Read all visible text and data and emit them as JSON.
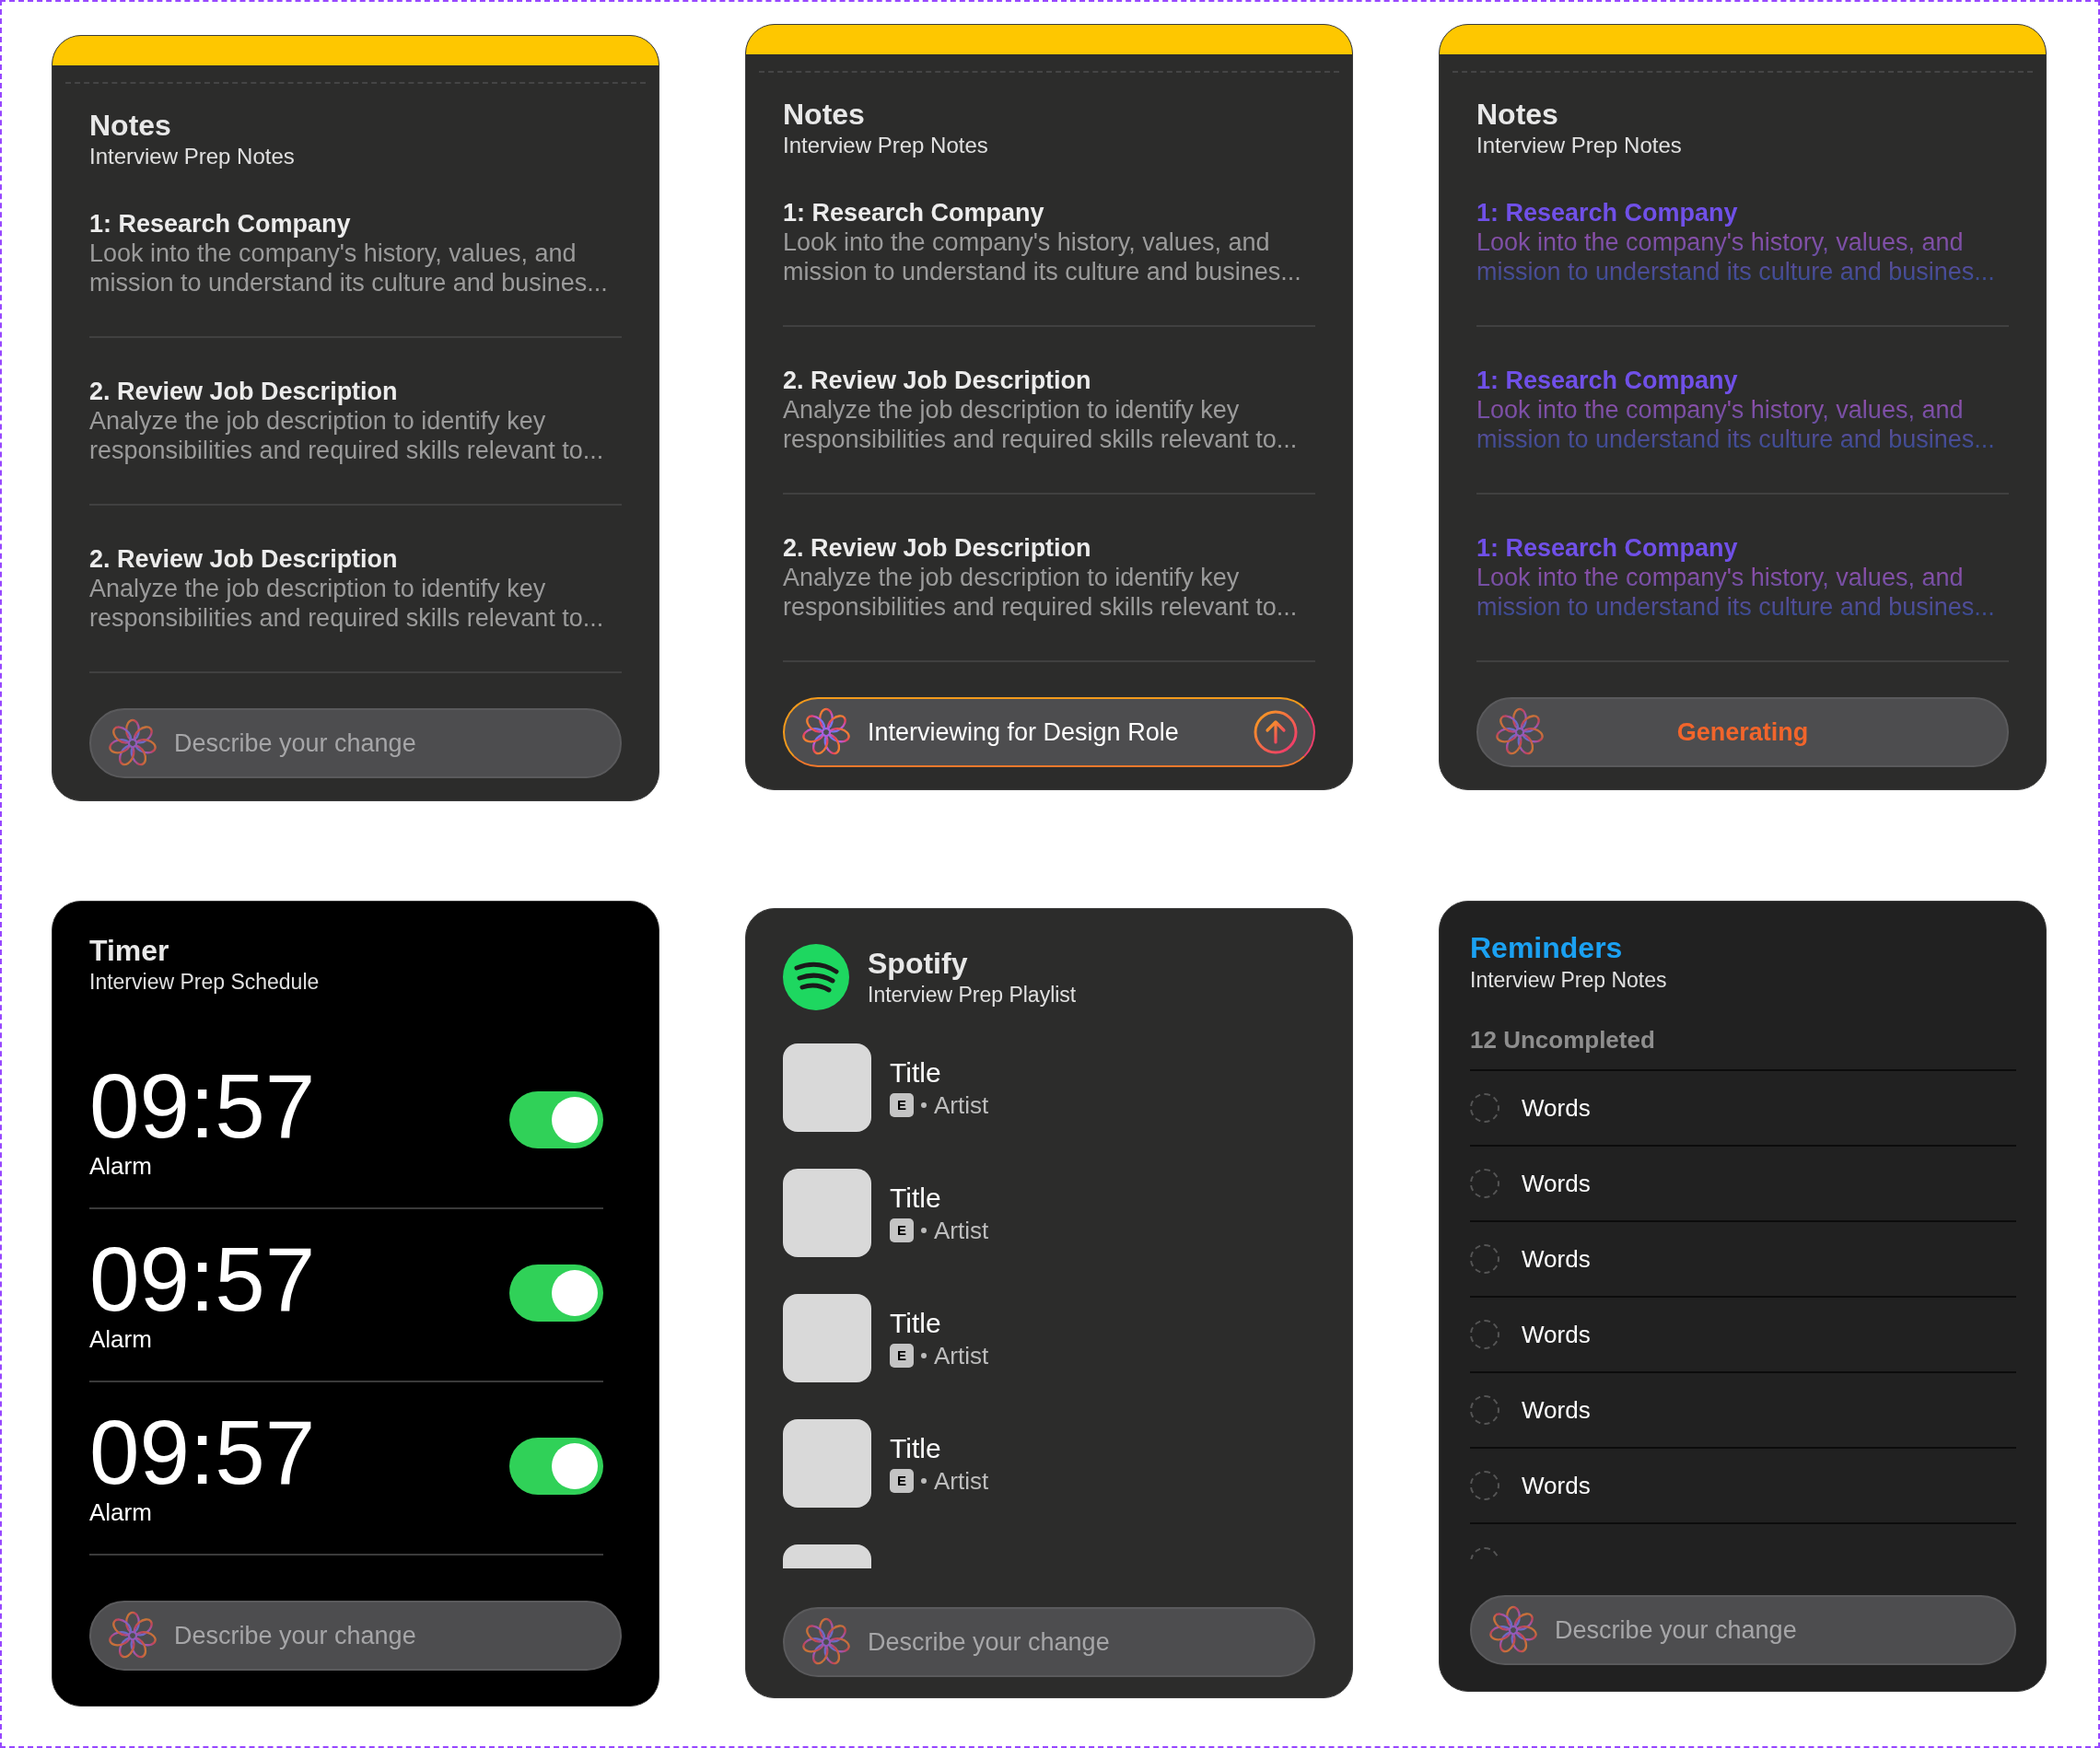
{
  "notes_cards": [
    {
      "title": "Notes",
      "subtitle": "Interview Prep Notes",
      "generating": false,
      "items": [
        {
          "heading": "1: Research Company",
          "body": "Look into the company's history, values, and mission to understand its culture and busines..."
        },
        {
          "heading": "2. Review Job Description",
          "body": "Analyze the job description to identify key responsibilities and required skills relevant to..."
        },
        {
          "heading": "2. Review Job Description",
          "body": "Analyze the job description to identify key responsibilities and required skills relevant to..."
        }
      ],
      "prompt": {
        "kind": "placeholder",
        "placeholder": "Describe your change"
      }
    },
    {
      "title": "Notes",
      "subtitle": "Interview Prep Notes",
      "generating": false,
      "items": [
        {
          "heading": "1: Research Company",
          "body": "Look into the company's history, values, and mission to understand its culture and busines..."
        },
        {
          "heading": "2. Review Job Description",
          "body": "Analyze the job description to identify key responsibilities and required skills relevant to..."
        },
        {
          "heading": "2. Review Job Description",
          "body": "Analyze the job description to identify key responsibilities and required skills relevant to..."
        }
      ],
      "prompt": {
        "kind": "value",
        "value": "Interviewing for Design Role"
      }
    },
    {
      "title": "Notes",
      "subtitle": "Interview Prep Notes",
      "generating": true,
      "items": [
        {
          "heading": "1: Research Company",
          "body": "Look into the company's history, values, and mission to understand its culture and busines..."
        },
        {
          "heading": "1: Research Company",
          "body": "Look into the company's history, values, and mission to understand its culture and busines..."
        },
        {
          "heading": "1: Research Company",
          "body": "Look into the company's history, values, and mission to understand its culture and busines..."
        }
      ],
      "prompt": {
        "kind": "status",
        "text": "Generating"
      }
    }
  ],
  "timer": {
    "title": "Timer",
    "subtitle": "Interview Prep Schedule",
    "alarms": [
      {
        "time": "09:57",
        "label": "Alarm",
        "on": true
      },
      {
        "time": "09:57",
        "label": "Alarm",
        "on": true
      },
      {
        "time": "09:57",
        "label": "Alarm",
        "on": true
      }
    ],
    "prompt": {
      "kind": "placeholder",
      "placeholder": "Describe your change"
    }
  },
  "spotify": {
    "title": "Spotify",
    "subtitle": "Interview Prep Playlist",
    "tracks": [
      {
        "title": "Title",
        "badge": "E",
        "artist": "Artist"
      },
      {
        "title": "Title",
        "badge": "E",
        "artist": "Artist"
      },
      {
        "title": "Title",
        "badge": "E",
        "artist": "Artist"
      },
      {
        "title": "Title",
        "badge": "E",
        "artist": "Artist"
      }
    ],
    "prompt": {
      "kind": "placeholder",
      "placeholder": "Describe your change"
    }
  },
  "reminders": {
    "title": "Reminders",
    "subtitle": "Interview Prep Notes",
    "count": "12 Uncompleted",
    "items": [
      {
        "text": "Words",
        "completed": false
      },
      {
        "text": "Words",
        "completed": false
      },
      {
        "text": "Words",
        "completed": false
      },
      {
        "text": "Words",
        "completed": false
      },
      {
        "text": "Words",
        "completed": false
      },
      {
        "text": "Words",
        "completed": false
      }
    ],
    "prompt": {
      "kind": "placeholder",
      "placeholder": "Describe your change"
    }
  }
}
